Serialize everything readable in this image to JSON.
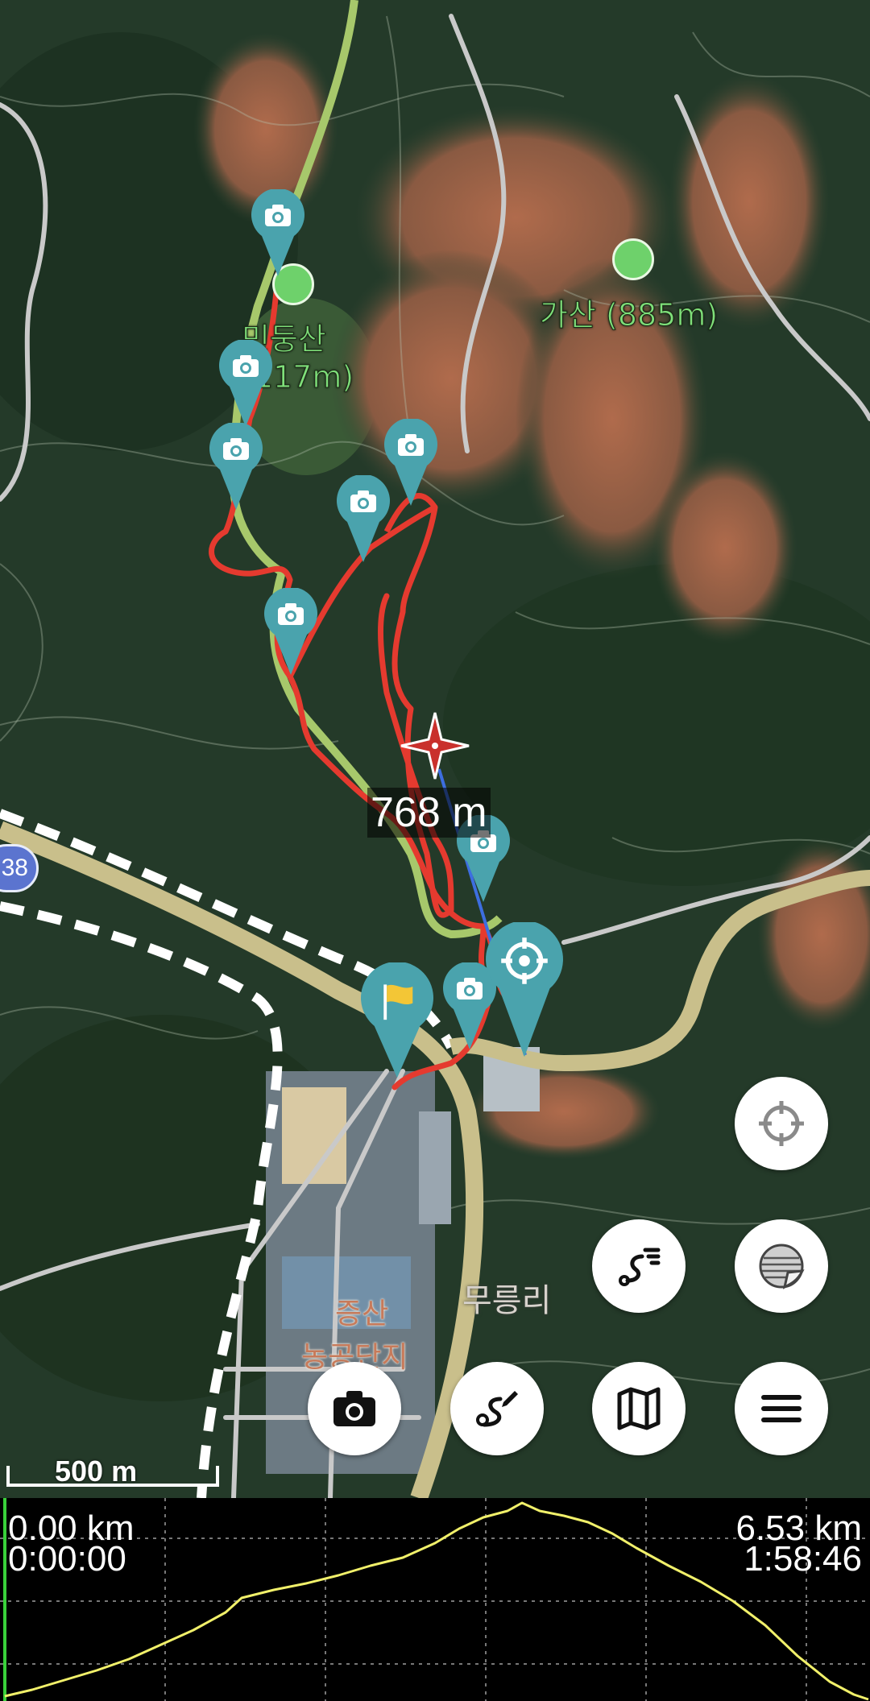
{
  "map": {
    "peaks": [
      {
        "name": "가산 (885m)"
      },
      {
        "name": "민둥산"
      },
      {
        "name": "(117m)"
      }
    ],
    "places": [
      "무릉리",
      "증산",
      "농공단지"
    ],
    "road_number": "38",
    "distance_to_cursor": "768 m",
    "scale_label": "500 m"
  },
  "buttons": {
    "locate": "locate-icon",
    "layers": "layers-icon",
    "route_list": "route-list-icon",
    "camera": "camera-icon",
    "draw_route": "draw-route-icon",
    "map": "map-icon",
    "menu": "menu-icon"
  },
  "profile": {
    "start_distance": "0.00 km",
    "start_time": "0:00:00",
    "end_distance": "6.53 km",
    "end_time": "1:58:46"
  },
  "colors": {
    "track": "#e53a2f",
    "trail": "#a7c86b",
    "pin": "#4aa3ad",
    "profile_line": "#f1f06a"
  }
}
